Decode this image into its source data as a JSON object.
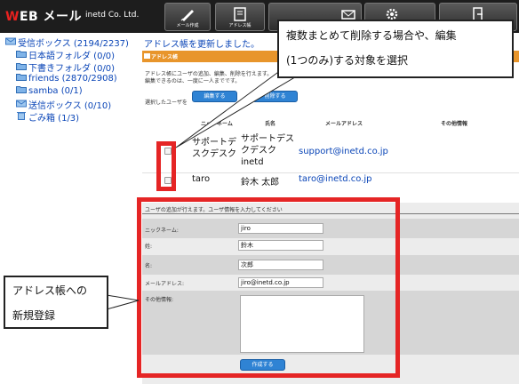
{
  "app": {
    "logo_prefix": "W",
    "logo_rest": "EB メール",
    "company": "inetd Co. Ltd."
  },
  "nav": [
    {
      "label": "メール作成",
      "icon": "compose-icon"
    },
    {
      "label": "アドレス帳",
      "icon": "address-book-icon"
    },
    {
      "label": "",
      "icon": "mail-icon"
    },
    {
      "label": "",
      "icon": "settings-icon"
    },
    {
      "label": "",
      "icon": "logout-icon"
    }
  ],
  "sidebar": {
    "items": [
      {
        "label": "受信ボックス (2194/2237)",
        "icon": "inbox-icon"
      },
      {
        "label": "日本語フォルダ (0/0)",
        "icon": "folder-icon"
      },
      {
        "label": "下書きフォルダ (0/0)",
        "icon": "folder-icon"
      },
      {
        "label": "friends (2870/2908)",
        "icon": "folder-icon"
      },
      {
        "label": "samba (0/1)",
        "icon": "folder-icon"
      },
      {
        "label": "送信ボックス (0/10)",
        "icon": "outbox-icon"
      },
      {
        "label": "ごみ箱 (1/3)",
        "icon": "trash-icon"
      }
    ]
  },
  "main": {
    "notice": "アドレス帳を更新しました。",
    "panel_title": "アドレス帳",
    "description_1": "アドレス帳にユーザの追加、編集、削除を行えます。",
    "description_2": "編集できるのは、一度に一人までです。",
    "selected_label": "選択したユーザを",
    "edit_button": "編集する",
    "delete_button": "削除する",
    "columns": {
      "nickname": "ニックネーム",
      "name": "氏名",
      "email": "メールアドレス",
      "other": "その他情報"
    },
    "rows": [
      {
        "nickname_1": "サポートデ",
        "nickname_2": "スクデスク",
        "name_1": "サポートデス",
        "name_2": "クデスク",
        "name_3": "inetd",
        "email": "support@inetd.co.jp"
      },
      {
        "nickname_1": "taro",
        "name_1": "鈴木 太郎",
        "email": "taro@inetd.co.jp"
      }
    ]
  },
  "form": {
    "title": "ユーザの追加が行えます。ユーザ情報を入力してください",
    "nickname_label": "ニックネーム:",
    "nickname_value": "jiro",
    "sei_label": "姓:",
    "sei_value": "鈴木",
    "mei_label": "名:",
    "mei_value": "次郎",
    "email_label": "メールアドレス:",
    "email_value": "jiro@inetd.co.jp",
    "other_label": "その他情報:",
    "create_button": "作成する"
  },
  "annotations": {
    "top_line_1": "複数まとめて削除する場合や、編集",
    "top_line_2": "(1つのみ)する対象を選択",
    "left_line_1": "アドレス帳への",
    "left_line_2": "新規登録"
  },
  "colors": {
    "accent_red": "#e52525",
    "panel_orange": "#e8952b",
    "link_blue": "#0a45b7",
    "button_blue": "#2f83d4"
  }
}
